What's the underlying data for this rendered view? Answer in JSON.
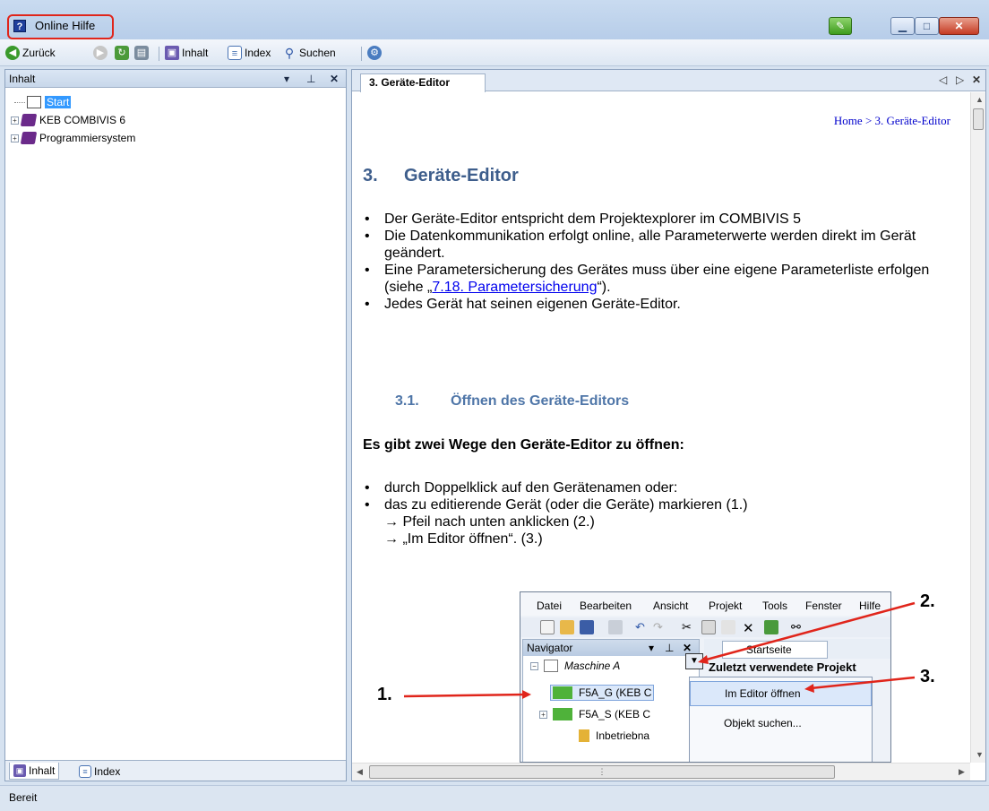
{
  "window": {
    "title": "Online Hilfe"
  },
  "toolbar": {
    "back_label": "Zurück",
    "contents_label": "Inhalt",
    "index_label": "Index",
    "search_label": "Suchen"
  },
  "left_pane": {
    "header": "Inhalt",
    "tree": [
      {
        "label": "Start",
        "selected": true
      },
      {
        "label": "KEB COMBIVIS 6"
      },
      {
        "label": "Programmiersystem"
      }
    ],
    "tabs": [
      {
        "label": "Inhalt",
        "active": true
      },
      {
        "label": "Index"
      }
    ]
  },
  "document": {
    "tab_title": "3. Geräte-Editor",
    "breadcrumb": "Home > 3. Geräte-Editor",
    "heading_num": "3.",
    "heading": "Geräte-Editor",
    "bullets": [
      "Der Geräte-Editor entspricht dem Projektexplorer im COMBIVIS 5",
      "Die Datenkommunikation erfolgt online, alle Parameterwerte werden direkt im Gerät geändert.",
      "Jedes Gerät hat seinen eigenen Geräte-Editor."
    ],
    "bullet3_pre": "Eine Parametersicherung des Gerätes muss über eine eigene Parameterliste erfolgen (siehe „",
    "bullet3_link": "7.18. Parametersicherung",
    "bullet3_post": "“).",
    "subheading_num": "3.1.",
    "subheading": "Öffnen des Geräte-Editors",
    "lead": "Es gibt zwei Wege den Geräte-Editor zu öffnen:",
    "ways": [
      "durch Doppelklick auf den Gerätenamen oder:",
      "das zu editierende Gerät (oder die Geräte) markieren (1.)"
    ],
    "arrow_steps": [
      "→ Pfeil nach unten anklicken (2.)",
      "→ „Im Editor öffnen“. (3.)"
    ]
  },
  "embedded_screenshot": {
    "menu": [
      "Datei",
      "Bearbeiten",
      "Ansicht",
      "Projekt",
      "Tools",
      "Fenster",
      "Hilfe"
    ],
    "navigator_title": "Navigator",
    "machine": "Maschine A",
    "rows": [
      "F5A_G (KEB C",
      "F5A_S (KEB C",
      "Inbetriebna"
    ],
    "start_tab": "Startseite",
    "recent": "Zuletzt verwendete Projekt",
    "context_menu": [
      "Im Editor öffnen",
      "Objekt suchen..."
    ],
    "annotations": [
      "1.",
      "2.",
      "3."
    ]
  },
  "statusbar": {
    "text": "Bereit"
  },
  "colors": {
    "heading": "#3e5e8c",
    "subheading": "#4f76a8",
    "link": "#0000ee",
    "annotation_arrow": "#e0251b",
    "selection": "#3399ff"
  }
}
